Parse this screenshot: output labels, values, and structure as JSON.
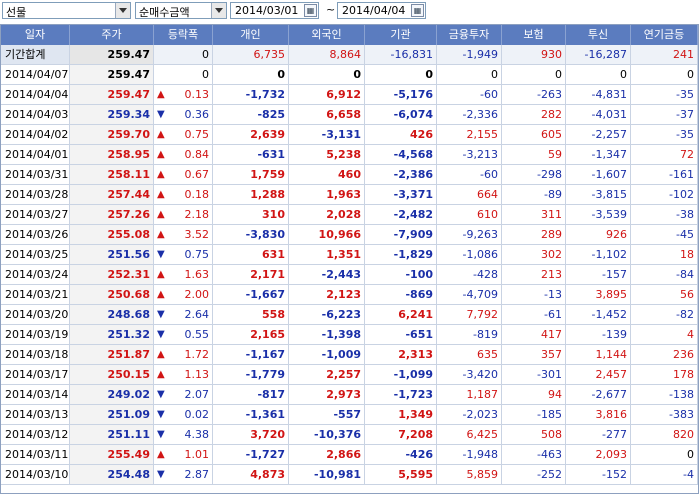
{
  "toolbar": {
    "category": "선물",
    "metric": "순매수금액",
    "start_date": "2014/03/01",
    "separator": "~",
    "end_date": "2014/04/04"
  },
  "table": {
    "headers": [
      "일자",
      "주가",
      "등락폭",
      "개인",
      "외국인",
      "기관",
      "금융투자",
      "보험",
      "투신",
      "연기금등"
    ],
    "total": {
      "date": "기간합계",
      "price": "259.47",
      "change": "0",
      "indiv": "6,735",
      "foreign": "8,864",
      "inst": "-16,831",
      "fin": "-1,949",
      "ins": "930",
      "trust": "-16,287",
      "pension": "241"
    },
    "rows": [
      {
        "date": "2014/04/07",
        "price": "259.47",
        "dir": "none",
        "change": "0",
        "indiv": "0",
        "foreign": "0",
        "inst": "0",
        "fin": "0",
        "ins": "0",
        "trust": "0",
        "pension": "0"
      },
      {
        "date": "2014/04/04",
        "price": "259.47",
        "dir": "up",
        "change": "0.13",
        "indiv": "-1,732",
        "foreign": "6,912",
        "inst": "-5,176",
        "fin": "-60",
        "ins": "-263",
        "trust": "-4,831",
        "pension": "-35"
      },
      {
        "date": "2014/04/03",
        "price": "259.34",
        "dir": "down",
        "change": "0.36",
        "indiv": "-825",
        "foreign": "6,658",
        "inst": "-6,074",
        "fin": "-2,336",
        "ins": "282",
        "trust": "-4,031",
        "pension": "-37"
      },
      {
        "date": "2014/04/02",
        "price": "259.70",
        "dir": "up",
        "change": "0.75",
        "indiv": "2,639",
        "foreign": "-3,131",
        "inst": "426",
        "fin": "2,155",
        "ins": "605",
        "trust": "-2,257",
        "pension": "-35"
      },
      {
        "date": "2014/04/01",
        "price": "258.95",
        "dir": "up",
        "change": "0.84",
        "indiv": "-631",
        "foreign": "5,238",
        "inst": "-4,568",
        "fin": "-3,213",
        "ins": "59",
        "trust": "-1,347",
        "pension": "72"
      },
      {
        "date": "2014/03/31",
        "price": "258.11",
        "dir": "up",
        "change": "0.67",
        "indiv": "1,759",
        "foreign": "460",
        "inst": "-2,386",
        "fin": "-60",
        "ins": "-298",
        "trust": "-1,607",
        "pension": "-161"
      },
      {
        "date": "2014/03/28",
        "price": "257.44",
        "dir": "up",
        "change": "0.18",
        "indiv": "1,288",
        "foreign": "1,963",
        "inst": "-3,371",
        "fin": "664",
        "ins": "-89",
        "trust": "-3,815",
        "pension": "-102"
      },
      {
        "date": "2014/03/27",
        "price": "257.26",
        "dir": "up",
        "change": "2.18",
        "indiv": "310",
        "foreign": "2,028",
        "inst": "-2,482",
        "fin": "610",
        "ins": "311",
        "trust": "-3,539",
        "pension": "-38"
      },
      {
        "date": "2014/03/26",
        "price": "255.08",
        "dir": "up",
        "change": "3.52",
        "indiv": "-3,830",
        "foreign": "10,966",
        "inst": "-7,909",
        "fin": "-9,263",
        "ins": "289",
        "trust": "926",
        "pension": "-45"
      },
      {
        "date": "2014/03/25",
        "price": "251.56",
        "dir": "down",
        "change": "0.75",
        "indiv": "631",
        "foreign": "1,351",
        "inst": "-1,829",
        "fin": "-1,086",
        "ins": "302",
        "trust": "-1,102",
        "pension": "18"
      },
      {
        "date": "2014/03/24",
        "price": "252.31",
        "dir": "up",
        "change": "1.63",
        "indiv": "2,171",
        "foreign": "-2,443",
        "inst": "-100",
        "fin": "-428",
        "ins": "213",
        "trust": "-157",
        "pension": "-84"
      },
      {
        "date": "2014/03/21",
        "price": "250.68",
        "dir": "up",
        "change": "2.00",
        "indiv": "-1,667",
        "foreign": "2,123",
        "inst": "-869",
        "fin": "-4,709",
        "ins": "-13",
        "trust": "3,895",
        "pension": "56"
      },
      {
        "date": "2014/03/20",
        "price": "248.68",
        "dir": "down",
        "change": "2.64",
        "indiv": "558",
        "foreign": "-6,223",
        "inst": "6,241",
        "fin": "7,792",
        "ins": "-61",
        "trust": "-1,452",
        "pension": "-82"
      },
      {
        "date": "2014/03/19",
        "price": "251.32",
        "dir": "down",
        "change": "0.55",
        "indiv": "2,165",
        "foreign": "-1,398",
        "inst": "-651",
        "fin": "-819",
        "ins": "417",
        "trust": "-139",
        "pension": "4"
      },
      {
        "date": "2014/03/18",
        "price": "251.87",
        "dir": "up",
        "change": "1.72",
        "indiv": "-1,167",
        "foreign": "-1,009",
        "inst": "2,313",
        "fin": "635",
        "ins": "357",
        "trust": "1,144",
        "pension": "236"
      },
      {
        "date": "2014/03/17",
        "price": "250.15",
        "dir": "up",
        "change": "1.13",
        "indiv": "-1,779",
        "foreign": "2,257",
        "inst": "-1,099",
        "fin": "-3,420",
        "ins": "-301",
        "trust": "2,457",
        "pension": "178"
      },
      {
        "date": "2014/03/14",
        "price": "249.02",
        "dir": "down",
        "change": "2.07",
        "indiv": "-817",
        "foreign": "2,973",
        "inst": "-1,723",
        "fin": "1,187",
        "ins": "94",
        "trust": "-2,677",
        "pension": "-138"
      },
      {
        "date": "2014/03/13",
        "price": "251.09",
        "dir": "down",
        "change": "0.02",
        "indiv": "-1,361",
        "foreign": "-557",
        "inst": "1,349",
        "fin": "-2,023",
        "ins": "-185",
        "trust": "3,816",
        "pension": "-383"
      },
      {
        "date": "2014/03/12",
        "price": "251.11",
        "dir": "down",
        "change": "4.38",
        "indiv": "3,720",
        "foreign": "-10,376",
        "inst": "7,208",
        "fin": "6,425",
        "ins": "508",
        "trust": "-277",
        "pension": "820"
      },
      {
        "date": "2014/03/11",
        "price": "255.49",
        "dir": "up",
        "change": "1.01",
        "indiv": "-1,727",
        "foreign": "2,866",
        "inst": "-426",
        "fin": "-1,948",
        "ins": "-463",
        "trust": "2,093",
        "pension": "0"
      },
      {
        "date": "2014/03/10",
        "price": "254.48",
        "dir": "down",
        "change": "2.87",
        "indiv": "4,873",
        "foreign": "-10,981",
        "inst": "5,595",
        "fin": "5,859",
        "ins": "-252",
        "trust": "-152",
        "pension": "-4"
      }
    ]
  },
  "colors": {
    "header_bg": "#5b7cbf",
    "positive": "#d11414",
    "negative": "#1a2fa8"
  },
  "icons": {
    "up": "triangle-up-icon",
    "down": "triangle-down-icon",
    "calendar": "calendar-icon"
  }
}
